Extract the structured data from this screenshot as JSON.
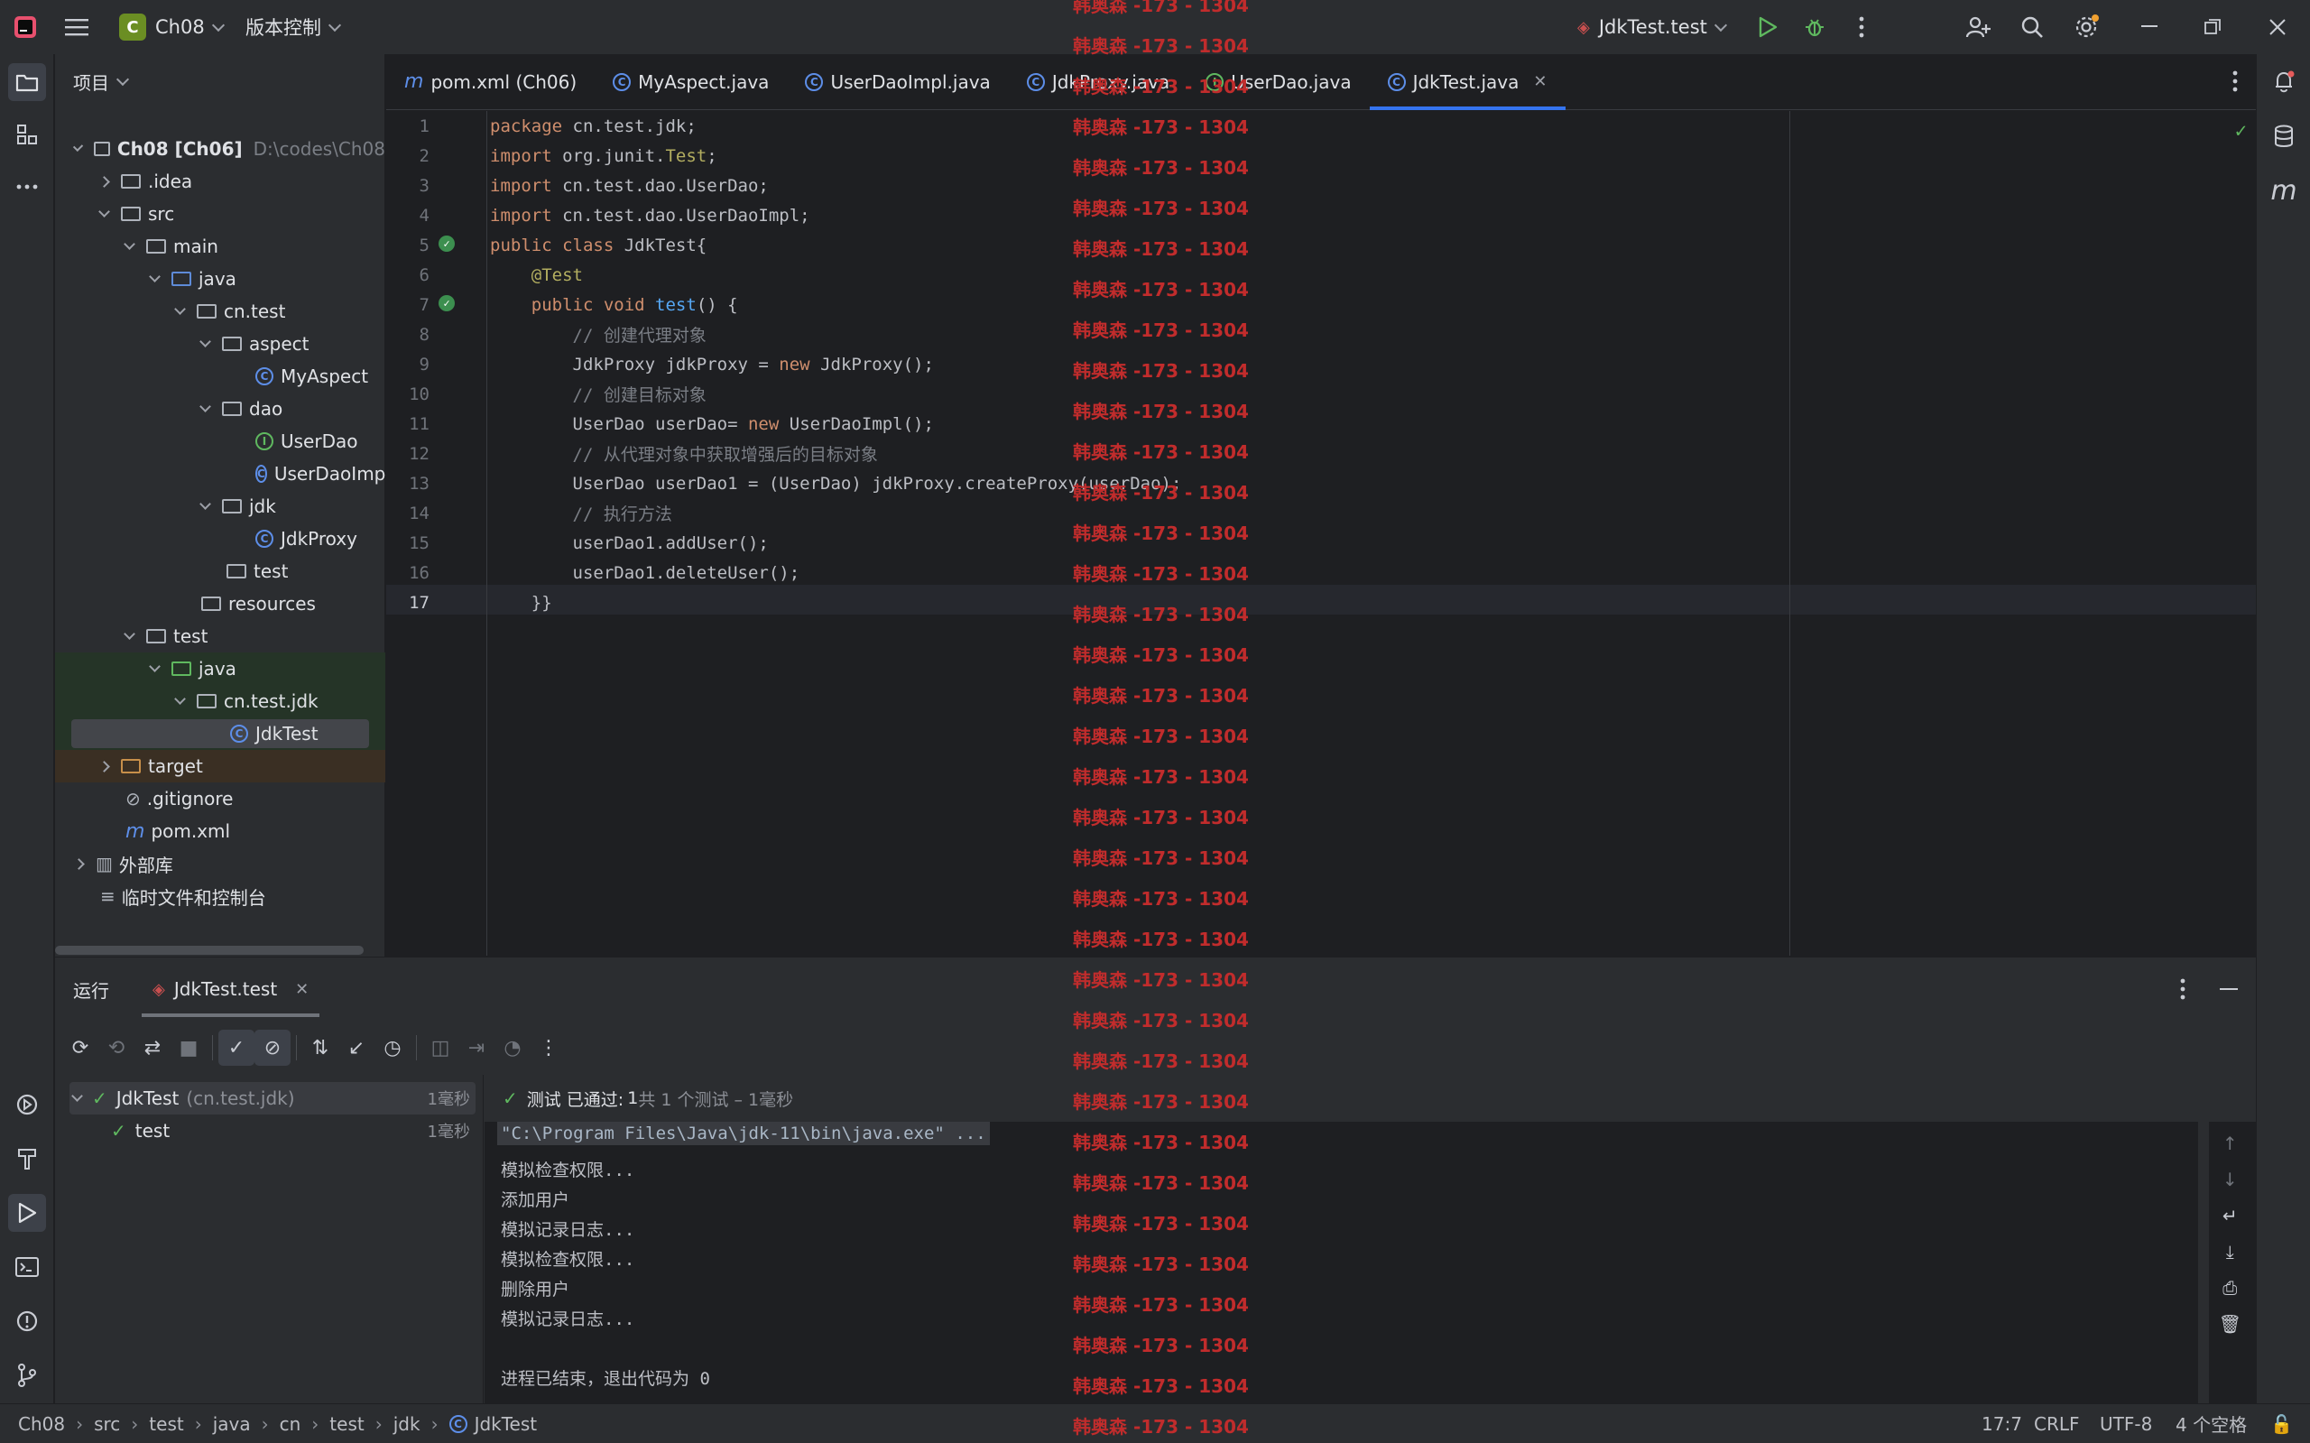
{
  "titlebar": {
    "project_badge": "C",
    "project_name": "Ch08",
    "vcs_label": "版本控制",
    "run_config": "JdkTest.test"
  },
  "left_strip": {
    "icons": [
      "folder-icon",
      "structure-icon",
      "more-icon",
      "services-icon",
      "build-icon",
      "run-icon",
      "terminal-icon",
      "problems-icon",
      "git-icon"
    ]
  },
  "project_panel": {
    "title": "项目",
    "tree": [
      {
        "label": "Ch08 [Ch06]",
        "hint": "D:\\codes\\Ch08"
      },
      {
        "label": ".idea"
      },
      {
        "label": "src"
      },
      {
        "label": "main"
      },
      {
        "label": "java"
      },
      {
        "label": "cn.test"
      },
      {
        "label": "aspect"
      },
      {
        "label": "MyAspect"
      },
      {
        "label": "dao"
      },
      {
        "label": "UserDao"
      },
      {
        "label": "UserDaoImpl"
      },
      {
        "label": "jdk"
      },
      {
        "label": "JdkProxy"
      },
      {
        "label": "test"
      },
      {
        "label": "resources"
      },
      {
        "label": "test"
      },
      {
        "label": "java"
      },
      {
        "label": "cn.test.jdk"
      },
      {
        "label": "JdkTest"
      },
      {
        "label": "target"
      },
      {
        "label": ".gitignore"
      },
      {
        "label": "pom.xml"
      },
      {
        "label": "外部库"
      },
      {
        "label": "临时文件和控制台"
      }
    ]
  },
  "tabs": [
    {
      "label": "pom.xml (Ch06)"
    },
    {
      "label": "MyAspect.java"
    },
    {
      "label": "UserDaoImpl.java"
    },
    {
      "label": "JdkProxy.java"
    },
    {
      "label": "UserDao.java"
    },
    {
      "label": "JdkTest.java"
    }
  ],
  "editor": {
    "line_numbers": [
      "1",
      "2",
      "3",
      "4",
      "5",
      "6",
      "7",
      "8",
      "9",
      "10",
      "11",
      "12",
      "13",
      "14",
      "15",
      "16",
      "17"
    ],
    "lines": [
      [
        {
          "t": "package ",
          "c": "kw"
        },
        {
          "t": "cn.test.jdk;"
        }
      ],
      [
        {
          "t": "import ",
          "c": "kw"
        },
        {
          "t": "org.junit."
        },
        {
          "t": "Test",
          "c": "ann"
        },
        {
          "t": ";"
        }
      ],
      [
        {
          "t": "import ",
          "c": "kw"
        },
        {
          "t": "cn.test.dao.UserDao;"
        }
      ],
      [
        {
          "t": "import ",
          "c": "kw"
        },
        {
          "t": "cn.test.dao.UserDaoImpl;"
        }
      ],
      [
        {
          "t": "public class ",
          "c": "kw"
        },
        {
          "t": "JdkTest{"
        }
      ],
      [
        {
          "t": "    "
        },
        {
          "t": "@Test",
          "c": "ann"
        }
      ],
      [
        {
          "t": "    "
        },
        {
          "t": "public void ",
          "c": "kw"
        },
        {
          "t": "test",
          "c": "fn"
        },
        {
          "t": "() {"
        }
      ],
      [
        {
          "t": "        "
        },
        {
          "t": "// 创建代理对象",
          "c": "cmt"
        }
      ],
      [
        {
          "t": "        JdkProxy jdkProxy = "
        },
        {
          "t": "new ",
          "c": "kw"
        },
        {
          "t": "JdkProxy();"
        }
      ],
      [
        {
          "t": "        "
        },
        {
          "t": "// 创建目标对象",
          "c": "cmt"
        }
      ],
      [
        {
          "t": "        UserDao userDao= "
        },
        {
          "t": "new ",
          "c": "kw"
        },
        {
          "t": "UserDaoImpl();"
        }
      ],
      [
        {
          "t": "        "
        },
        {
          "t": "// 从代理对象中获取增强后的目标对象",
          "c": "cmt"
        }
      ],
      [
        {
          "t": "        UserDao userDao1 = (UserDao) jdkProxy.createProxy(userDao);"
        }
      ],
      [
        {
          "t": "        "
        },
        {
          "t": "// 执行方法",
          "c": "cmt"
        }
      ],
      [
        {
          "t": "        userDao1.addUser();"
        }
      ],
      [
        {
          "t": "        userDao1.deleteUser();"
        }
      ],
      [
        {
          "t": "    }}"
        }
      ]
    ]
  },
  "run_panel": {
    "title": "运行",
    "tab_label": "JdkTest.test",
    "status_prefix": "测试 已通过:",
    "status_count": "1",
    "status_detail": "共 1 个测试 – 1毫秒",
    "tests": [
      {
        "name": "JdkTest",
        "pkg": "(cn.test.jdk)",
        "time": "1毫秒"
      },
      {
        "name": "test",
        "pkg": "",
        "time": "1毫秒"
      }
    ],
    "console": [
      "\"C:\\Program Files\\Java\\jdk-11\\bin\\java.exe\" ...",
      "模拟检查权限...",
      "添加用户",
      "模拟记录日志...",
      "模拟检查权限...",
      "删除用户",
      "模拟记录日志...",
      "",
      "进程已结束，退出代码为 0"
    ]
  },
  "statusbar": {
    "breadcrumbs": [
      "Ch08",
      "src",
      "test",
      "java",
      "cn",
      "test",
      "jdk",
      "JdkTest"
    ],
    "position": "17:7",
    "line_sep": "CRLF",
    "encoding": "UTF-8",
    "indent": "4 个空格"
  },
  "watermark": {
    "text": "韩奥森 -173 - 1304"
  },
  "colors": {
    "accent": "#3574f0",
    "success": "#5fb85f",
    "watermark": "#c12c2c"
  }
}
